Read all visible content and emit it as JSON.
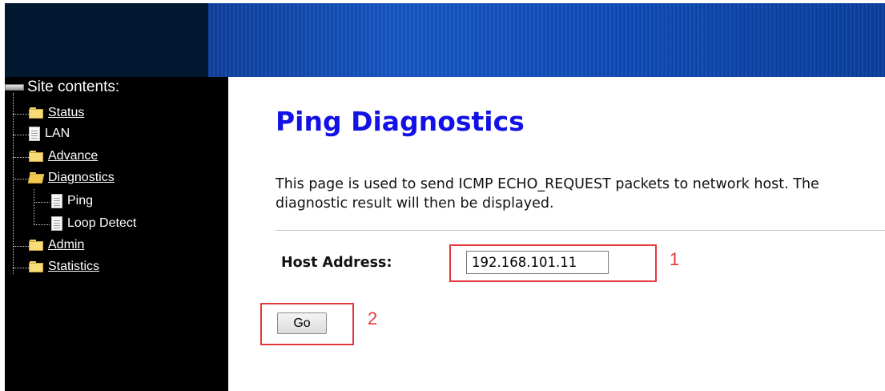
{
  "sidebar": {
    "heading": "Site contents:",
    "items": [
      {
        "label": "Status",
        "icon": "folder-icon"
      },
      {
        "label": "LAN",
        "icon": "document-icon"
      },
      {
        "label": "Advance",
        "icon": "folder-icon"
      },
      {
        "label": "Diagnostics",
        "icon": "folder-open-icon"
      },
      {
        "label": "Ping",
        "icon": "document-icon"
      },
      {
        "label": "Loop Detect",
        "icon": "document-icon"
      },
      {
        "label": "Admin",
        "icon": "folder-icon"
      },
      {
        "label": "Statistics",
        "icon": "folder-icon"
      }
    ]
  },
  "main": {
    "title": "Ping Diagnostics",
    "description": "This page is used to send ICMP ECHO_REQUEST packets to network host. The diagnostic result will then be displayed.",
    "host_label": "Host Address:",
    "host_value": "192.168.101.11",
    "go_label": "Go"
  },
  "annotations": {
    "step1": "1",
    "step2": "2"
  },
  "colors": {
    "title": "#1212e6",
    "annotation": "#e4393c",
    "sidebar_bg": "#000000"
  }
}
